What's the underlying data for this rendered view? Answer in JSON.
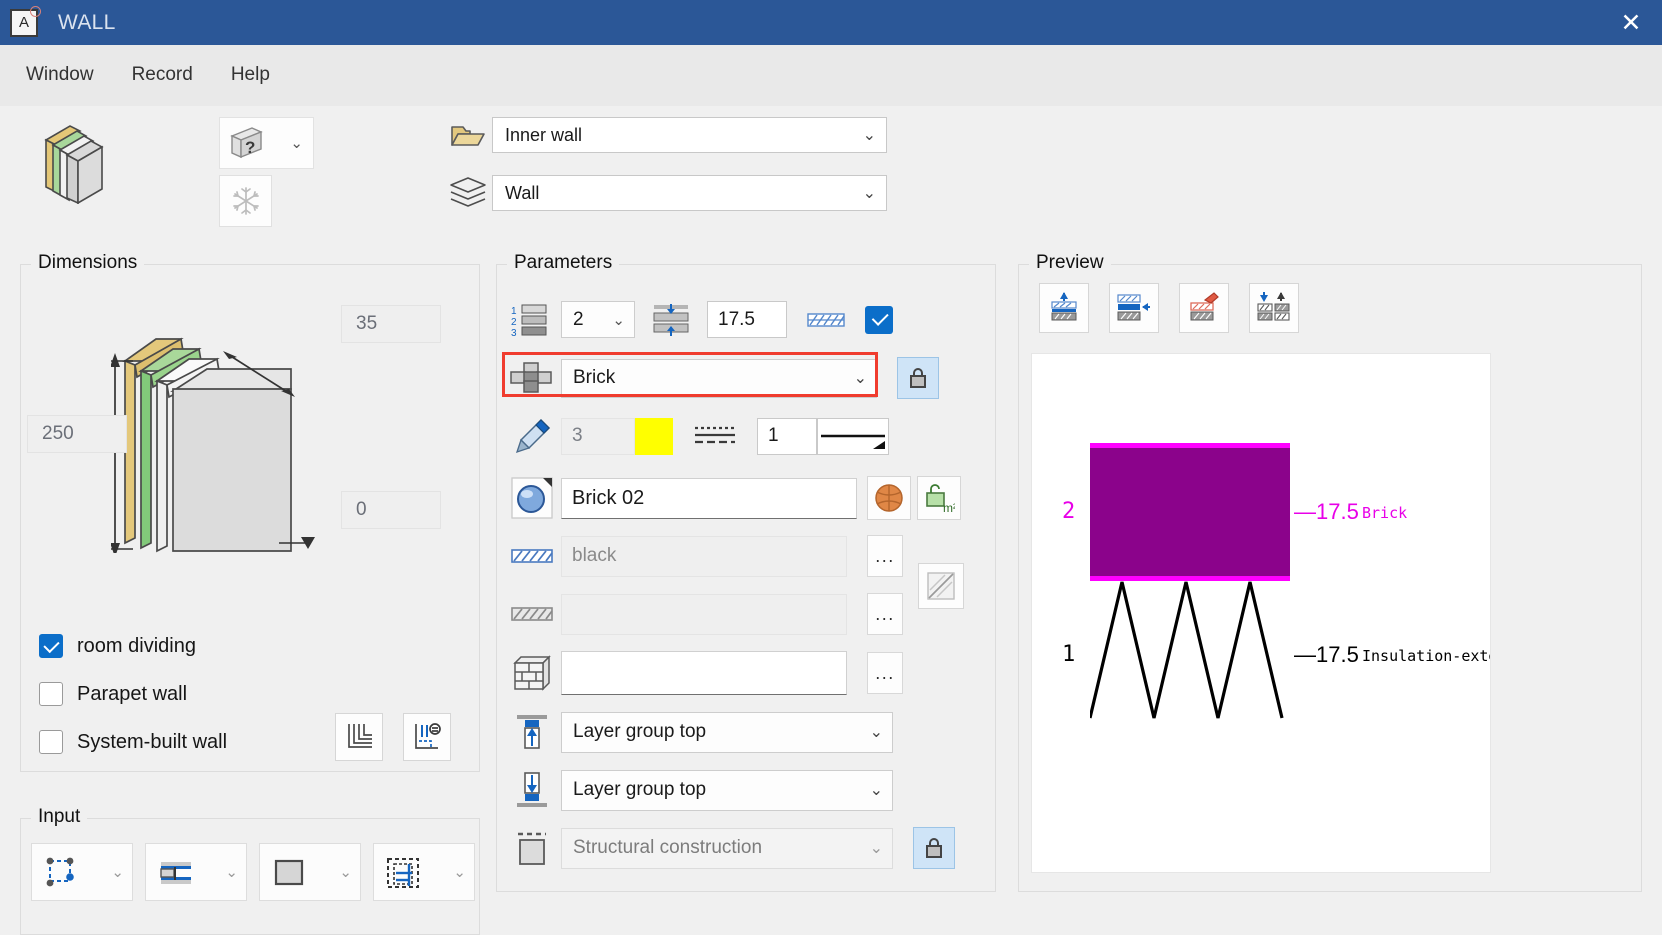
{
  "window": {
    "title": "WALL",
    "app_icon": "A",
    "close_label": "✕"
  },
  "menubar": {
    "items": [
      {
        "label": "Window"
      },
      {
        "label": "Record"
      },
      {
        "label": "Help"
      }
    ]
  },
  "toolbar": {
    "wall_preview_icon": "wall-layers-3d-icon",
    "help_button": {
      "glyph": "?",
      "chevron": "⌄"
    },
    "freeze_button": {
      "glyph": "❄"
    },
    "folder_combo": {
      "icon": "folder-open-icon",
      "value": "Inner wall",
      "chevron": "⌄"
    },
    "layer_combo": {
      "icon": "layers-stack-icon",
      "value": "Wall",
      "chevron": "⌄"
    }
  },
  "dimensions": {
    "legend": "Dimensions",
    "thickness": "35",
    "height": "250",
    "base": "0",
    "checkboxes": [
      {
        "label": "room dividing",
        "checked": true
      },
      {
        "label": "Parapet wall",
        "checked": false
      },
      {
        "label": "System-built wall",
        "checked": false
      }
    ],
    "buttons": [
      {
        "name": "wall-corner-layers-button"
      },
      {
        "name": "wall-reference-settings-button"
      }
    ]
  },
  "input": {
    "legend": "Input",
    "controls": [
      {
        "name": "input-mode-points",
        "chevron": "⌄"
      },
      {
        "name": "input-mode-reference-line",
        "chevron": "⌄"
      },
      {
        "name": "input-mode-solid",
        "chevron": "⌄"
      },
      {
        "name": "input-mode-dashed-grid",
        "chevron": "⌄"
      }
    ]
  },
  "parameters": {
    "legend": "Parameters",
    "layer_count": {
      "icon": "layer-number-icon",
      "value": "2",
      "chevron": "⌄"
    },
    "layer_thickness": {
      "icon": "layer-thickness-icon",
      "value": "17.5"
    },
    "hatch_toggle": {
      "icon": "hatch-blue-icon",
      "checked": true
    },
    "material": {
      "icon": "material-cross-icon",
      "value": "Brick",
      "chevron": "⌄",
      "highlighted": true
    },
    "material_lock": {
      "icon": "lock-closed-icon",
      "locked": true
    },
    "pen": {
      "icon": "pencil-icon",
      "value": "3",
      "color": "#ffff00"
    },
    "linetype": {
      "icon": "line-type-icon",
      "value": "1",
      "preview": "line-weight-preview"
    },
    "surface": {
      "icon": "surface-sphere-icon",
      "value": "Brick 02",
      "ball": "texture-ball-icon",
      "area_unit": "m²",
      "area_icon": "area-unlock-icon"
    },
    "hatch_fill": {
      "icon": "hatch-blue-small-icon",
      "value": "",
      "placeholder": "black",
      "dots": "..."
    },
    "hatch_bg": {
      "icon": "hatch-gray-icon",
      "value": "",
      "placeholder": "",
      "dots": "..."
    },
    "hatch_bg_btn": {
      "icon": "hatch-preview-icon"
    },
    "wall_pattern": {
      "icon": "brick-wall-icon",
      "value": "",
      "dots": "..."
    },
    "top_connection": {
      "icon": "layer-top-arrow-icon",
      "value": "Layer group top",
      "chevron": "⌄"
    },
    "bottom_connection": {
      "icon": "layer-bottom-arrow-icon",
      "value": "Layer group top",
      "chevron": "⌄"
    },
    "component": {
      "icon": "dashed-component-icon",
      "value": "Structural construction",
      "chevron": "⌄",
      "disabled": true
    },
    "component_lock": {
      "icon": "lock-closed-icon",
      "locked": true
    }
  },
  "preview": {
    "legend": "Preview",
    "tools": [
      {
        "name": "layer-move-up-button"
      },
      {
        "name": "layer-select-button"
      },
      {
        "name": "layer-paint-button"
      },
      {
        "name": "layer-swap-button"
      }
    ],
    "layers": [
      {
        "index": "2",
        "thickness": "—17.5",
        "material": "Brick",
        "fill": "#8b038b",
        "edge": "#ff00ff",
        "text_color": "#e800e8",
        "selected": true,
        "pattern": "solid"
      },
      {
        "index": "1",
        "thickness": "—17.5",
        "material": "Insulation-exterior",
        "fill": "#ffffff",
        "edge": "#000000",
        "text_color": "#000000",
        "selected": false,
        "pattern": "zigzag"
      }
    ]
  },
  "colors": {
    "title_bar": "#2b5797",
    "accent_blue": "#0b6ec9",
    "highlight_red": "#f03c2e",
    "swatch_yellow": "#ffff00",
    "panel_bg": "#f0f0f0"
  }
}
